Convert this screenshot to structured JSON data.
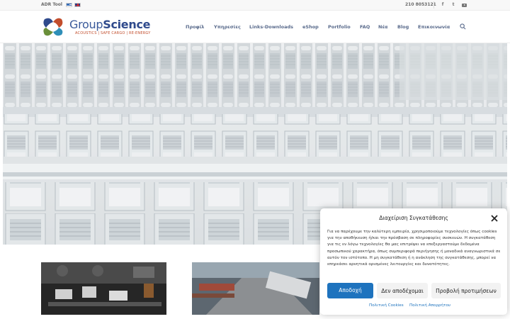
{
  "topbar": {
    "tool_label": "ADR Tool",
    "phone": "210 8053121",
    "languages": [
      "greek-flag",
      "english-flag"
    ],
    "social": [
      "facebook-icon",
      "twitter-icon",
      "youtube-icon"
    ]
  },
  "header": {
    "brand_group": "Group",
    "brand_science": "Science",
    "tagline": "ACOUSTICS | SAFE CARGO | RE-ENERGY",
    "nav": [
      "Προφίλ",
      "Υπηρεσίες",
      "Links-Downloads",
      "eShop",
      "Portfolio",
      "FAQ",
      "Νέα",
      "Blog",
      "Επικοινωνία"
    ]
  },
  "colors": {
    "brand_blue": "#2f4a8c",
    "accent_orange": "#c24d2c",
    "primary_button": "#1e73be"
  },
  "cookie": {
    "title": "Διαχείριση Συγκατάθεσης",
    "body": "Για να παρέχουμε την καλύτερη εμπειρία, χρησιμοποιούμε τεχνολογίες όπως cookies για την αποθήκευση ή/και την πρόσβαση σε πληροφορίες συσκευών. Η συγκατάθεση για τις εν λόγω τεχνολογίες θα μας επιτρέψει να επεξεργαστούμε δεδομένα προσωπικού χαρακτήρα, όπως συμπεριφορά περιήγησης ή μοναδικά αναγνωριστικά σε αυτόν τον ιστότοπο. Η μη συγκατάθεση ή η ανάκληση της συγκατάθεσης, μπορεί να επηρεάσει αρνητικά ορισμένες λειτουργίες και δυνατότητες.",
    "accept": "Αποδοχή",
    "deny": "Δεν αποδέχομαι",
    "preferences": "Προβολή προτιμήσεων",
    "cookie_policy": "Πολιτική Cookies",
    "privacy_policy": "Πολιτική Απορρήτου"
  }
}
